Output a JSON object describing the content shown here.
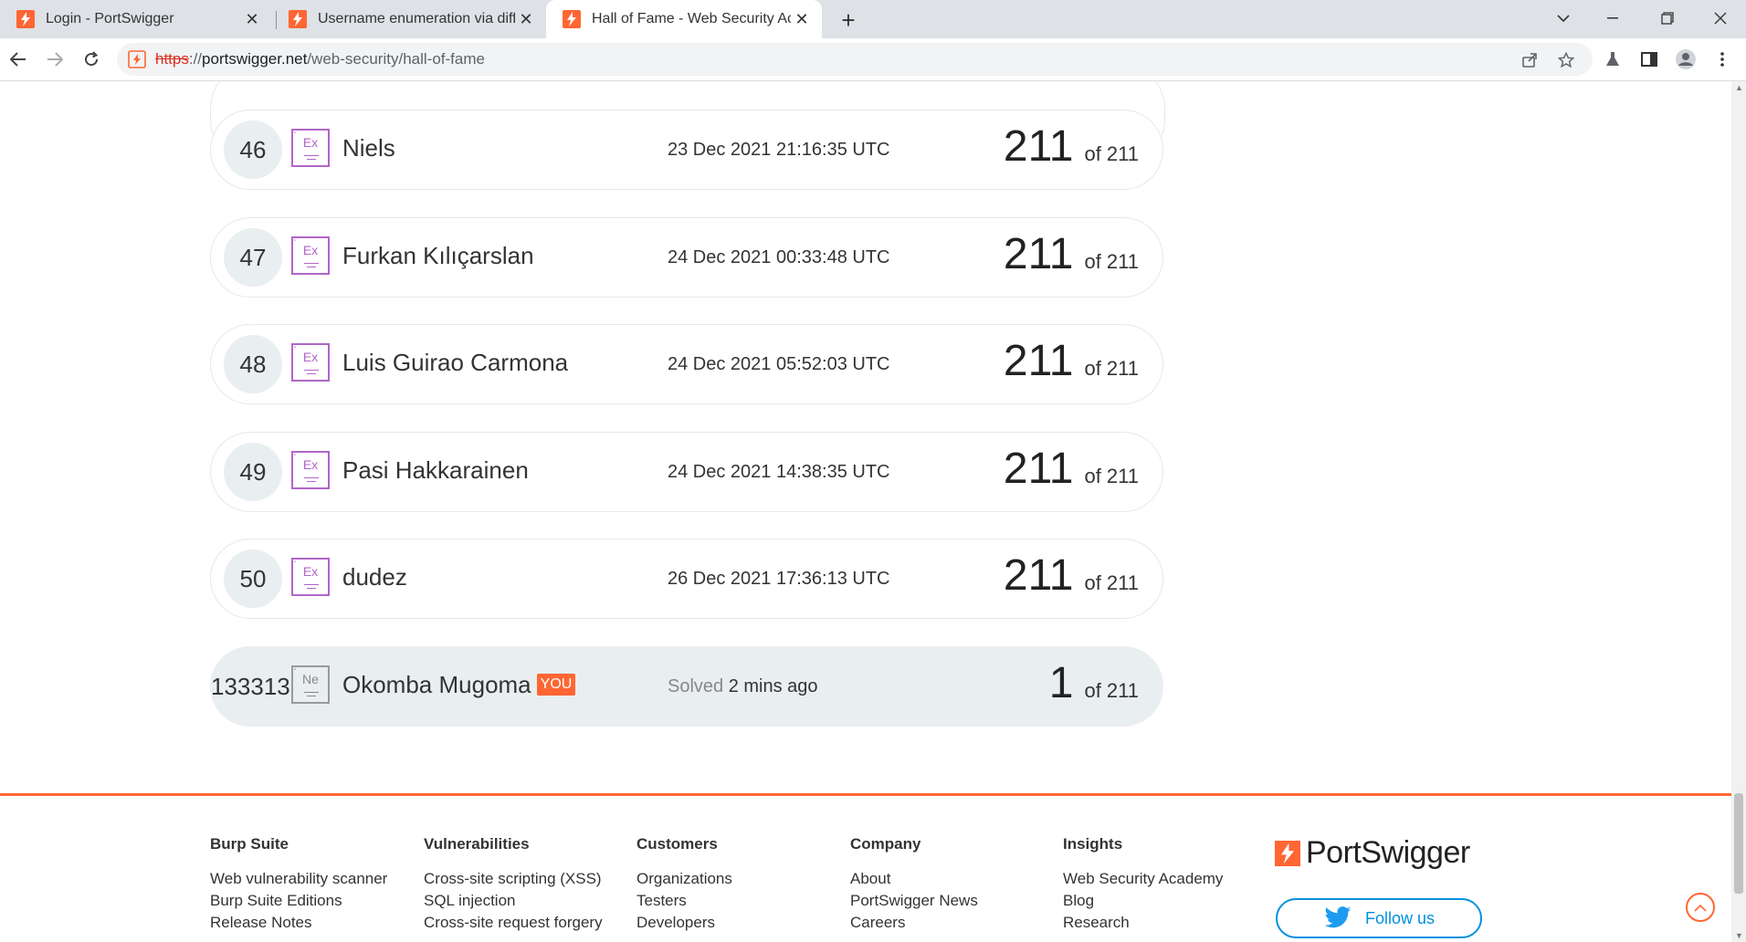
{
  "browser": {
    "tabs": [
      {
        "title": "Login - PortSwigger",
        "active": false
      },
      {
        "title": "Username enumeration via differ",
        "active": false
      },
      {
        "title": "Hall of Fame - Web Security Acad",
        "active": true
      }
    ],
    "url_scheme": "https",
    "url_host": "portswigger.net",
    "url_path": "/web-security/hall-of-fame",
    "url_sep": "://"
  },
  "leaderboard": {
    "rows": [
      {
        "rank": "46",
        "level": "Ex",
        "name": "Niels",
        "date": "23 Dec 2021 21:16:35 UTC",
        "score": "211",
        "total": "of 211"
      },
      {
        "rank": "47",
        "level": "Ex",
        "name": "Furkan Kılıçarslan",
        "date": "24 Dec 2021 00:33:48 UTC",
        "score": "211",
        "total": "of 211"
      },
      {
        "rank": "48",
        "level": "Ex",
        "name": "Luis Guirao Carmona",
        "date": "24 Dec 2021 05:52:03 UTC",
        "score": "211",
        "total": "of 211"
      },
      {
        "rank": "49",
        "level": "Ex",
        "name": "Pasi Hakkarainen",
        "date": "24 Dec 2021 14:38:35 UTC",
        "score": "211",
        "total": "of 211"
      },
      {
        "rank": "50",
        "level": "Ex",
        "name": "dudez",
        "date": "26 Dec 2021 17:36:13 UTC",
        "score": "211",
        "total": "of 211"
      }
    ],
    "you": {
      "rank": "133313",
      "level": "Ne",
      "name": "Okomba Mugoma",
      "tag": "YOU",
      "solved_label": "Solved",
      "solved_time": "2 mins ago",
      "score": "1",
      "total": "of 211"
    }
  },
  "footer": {
    "columns": [
      {
        "heading": "Burp Suite",
        "links": [
          "Web vulnerability scanner",
          "Burp Suite Editions",
          "Release Notes"
        ]
      },
      {
        "heading": "Vulnerabilities",
        "links": [
          "Cross-site scripting (XSS)",
          "SQL injection",
          "Cross-site request forgery"
        ]
      },
      {
        "heading": "Customers",
        "links": [
          "Organizations",
          "Testers",
          "Developers"
        ]
      },
      {
        "heading": "Company",
        "links": [
          "About",
          "PortSwigger News",
          "Careers"
        ]
      },
      {
        "heading": "Insights",
        "links": [
          "Web Security Academy",
          "Blog",
          "Research"
        ]
      }
    ],
    "brand": "PortSwigger",
    "follow_label": "Follow us"
  },
  "colors": {
    "accent": "#ff6633",
    "expert_badge": "#b066c8",
    "twitter": "#0090e0"
  }
}
